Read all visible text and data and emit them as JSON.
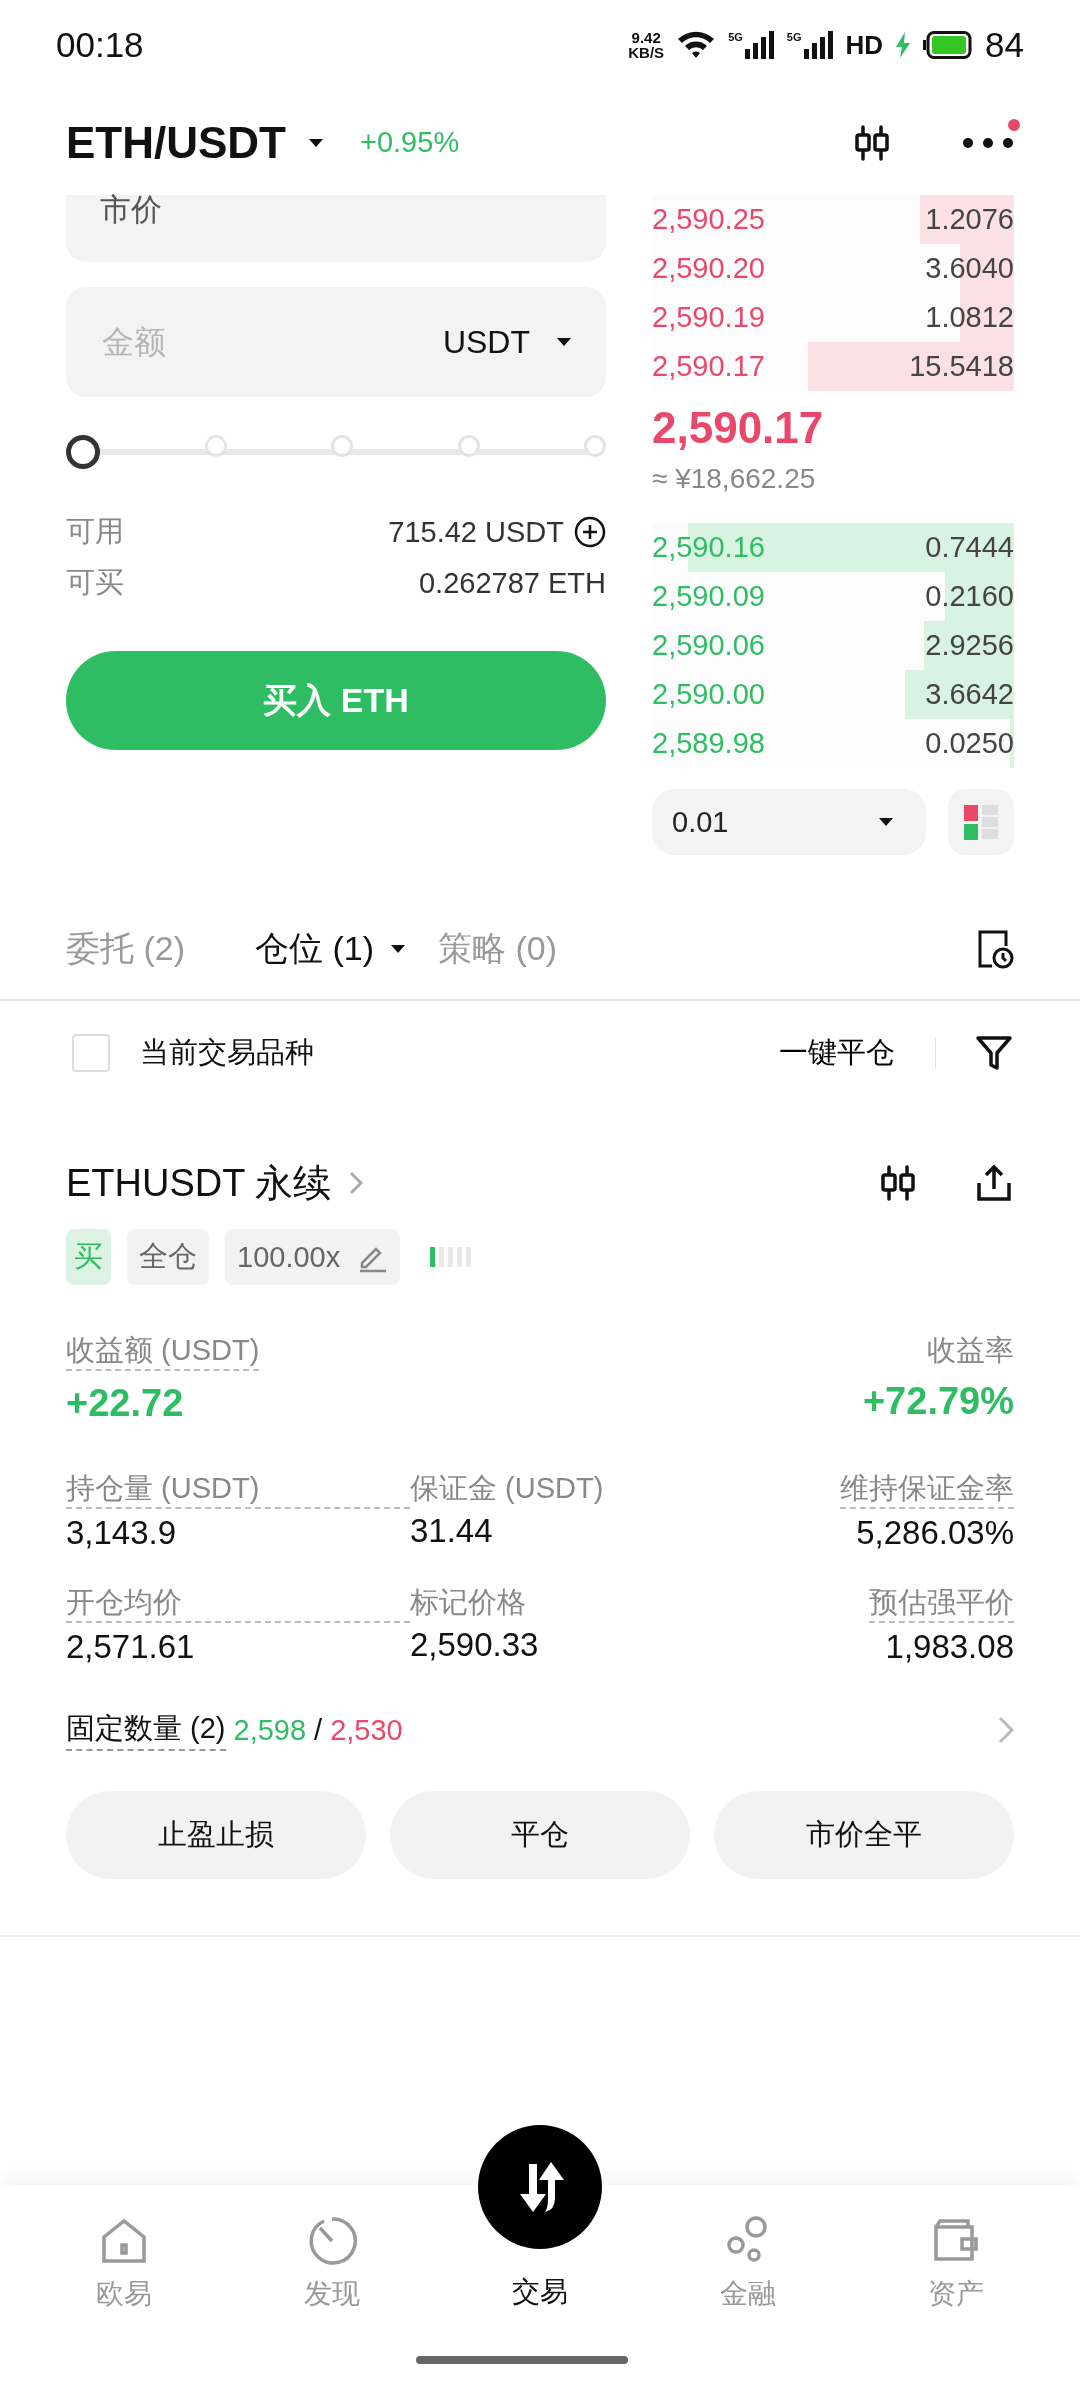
{
  "status_bar": {
    "time": "00:18",
    "speed_value": "9.42",
    "speed_unit": "KB/S",
    "network_1": "5G",
    "network_2": "5G",
    "hd": "HD",
    "charging": true,
    "battery": "84"
  },
  "header": {
    "pair": "ETH/USDT",
    "change": "+0.95%",
    "notification_dot": true
  },
  "order_form": {
    "order_type": "市价",
    "amount_placeholder": "金额",
    "amount_unit": "USDT",
    "slider": {
      "level": 0
    },
    "available_label": "可用",
    "available_value": "715.42 USDT",
    "buyable_label": "可买",
    "buyable_value": "0.262787 ETH",
    "buy_button": "买入 ETH"
  },
  "order_book": {
    "asks": [
      {
        "price": "2,590.25",
        "size": "1.2076",
        "level": 0.26
      },
      {
        "price": "2,590.20",
        "size": "3.6040",
        "level": 0.15
      },
      {
        "price": "2,590.19",
        "size": "1.0812",
        "level": 0.15
      },
      {
        "price": "2,590.17",
        "size": "15.5418",
        "level": 0.57
      }
    ],
    "last_price": "2,590.17",
    "last_price_cny": "≈ ¥18,662.25",
    "bids": [
      {
        "price": "2,590.16",
        "size": "0.7444",
        "level": 0.9
      },
      {
        "price": "2,590.09",
        "size": "0.2160",
        "level": 0.19
      },
      {
        "price": "2,590.06",
        "size": "2.9256",
        "level": 0.25
      },
      {
        "price": "2,590.00",
        "size": "3.6642",
        "level": 0.3
      },
      {
        "price": "2,589.98",
        "size": "0.0250",
        "level": 0.01
      }
    ],
    "depth_step": "0.01"
  },
  "order_tabs": [
    {
      "label": "委托 (2)",
      "selected": false,
      "dropdown": false
    },
    {
      "label": "仓位 (1)",
      "selected": true,
      "dropdown": true
    },
    {
      "label": "策略 (0)",
      "selected": false,
      "dropdown": false
    }
  ],
  "filter_row": {
    "label": "当前交易品种",
    "checked": false,
    "close_all": "一键平仓"
  },
  "position": {
    "symbol": "ETHUSDT 永续",
    "side": "买",
    "margin_mode": "全仓",
    "leverage": "100.00x",
    "risk": {
      "level": 0.2
    },
    "pnl_label": "收益额 (USDT)",
    "pnl": "+22.72",
    "roe_label": "收益率",
    "roe": "+72.79%",
    "stats": [
      {
        "label": "持仓量 (USDT)",
        "value": "3,143.9",
        "dotted": true
      },
      {
        "label": "保证金 (USDT)",
        "value": "31.44",
        "dotted": false
      },
      {
        "label": "维持保证金率",
        "value": "5,286.03%",
        "dotted": true
      },
      {
        "label": "开仓均价",
        "value": "2,571.61",
        "dotted": true
      },
      {
        "label": "标记价格",
        "value": "2,590.33",
        "dotted": false
      },
      {
        "label": "预估强平价",
        "value": "1,983.08",
        "dotted": true
      }
    ],
    "tpsl_label": "固定数量 (2)",
    "tp": "2,598",
    "separator": "/",
    "sl": "2,530",
    "actions": [
      "止盈止损",
      "平仓",
      "市价全平"
    ]
  },
  "bottom_nav": [
    {
      "label": "欧易",
      "kind": "home",
      "selected": false
    },
    {
      "label": "发现",
      "kind": "discover",
      "selected": false
    },
    {
      "label": "交易",
      "kind": "trade",
      "selected": true
    },
    {
      "label": "金融",
      "kind": "bubbles",
      "selected": false
    },
    {
      "label": "资产",
      "kind": "wallet",
      "selected": false
    }
  ]
}
